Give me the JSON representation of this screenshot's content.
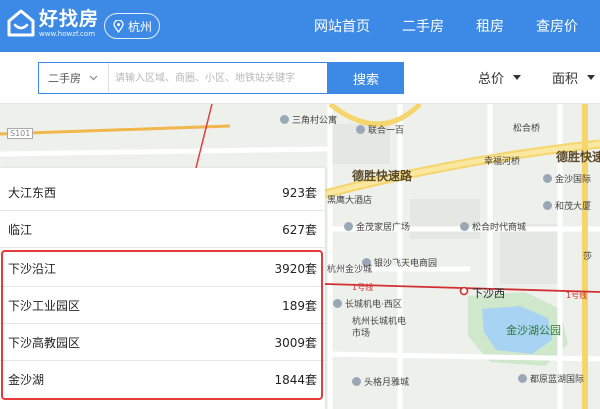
{
  "header": {
    "logo_text": "好找房",
    "logo_url": "www.howzf.com",
    "city": "杭州",
    "nav": [
      "网站首页",
      "二手房",
      "租房",
      "查房价"
    ]
  },
  "search": {
    "type_label": "二手房",
    "placeholder": "请输入区域、商圈、小区、地铁站关键字",
    "button_label": "搜索",
    "filters": [
      "总价",
      "面积"
    ]
  },
  "map": {
    "road_label": "德胜快速路",
    "road_label_right": "德胜快速",
    "highway_label": "S101",
    "metro_labels": [
      "1号线",
      "1号线"
    ],
    "pois": [
      "三角村公寓",
      "联合一百",
      "松合桥",
      "幸福河桥",
      "金沙国际",
      "和茂大厦",
      "黑鹰大酒店",
      "金茂家居广场",
      "松合时代商城",
      "银沙飞天电商园",
      "杭州金沙城",
      "长城机电·西区",
      "杭州长城机电市场",
      "下沙西",
      "金沙湖公园",
      "头格月雅城",
      "都原蓝湖国际",
      "莎"
    ]
  },
  "list": [
    {
      "name": "大江东西",
      "count": "923套"
    },
    {
      "name": "临江",
      "count": "627套"
    },
    {
      "name": "下沙沿江",
      "count": "3920套"
    },
    {
      "name": "下沙工业园区",
      "count": "189套"
    },
    {
      "name": "下沙高教园区",
      "count": "3009套"
    },
    {
      "name": "金沙湖",
      "count": "1844套"
    }
  ],
  "colors": {
    "brand": "#3d8ae6",
    "highlight": "#e53b3b",
    "metro": "#d03030"
  }
}
